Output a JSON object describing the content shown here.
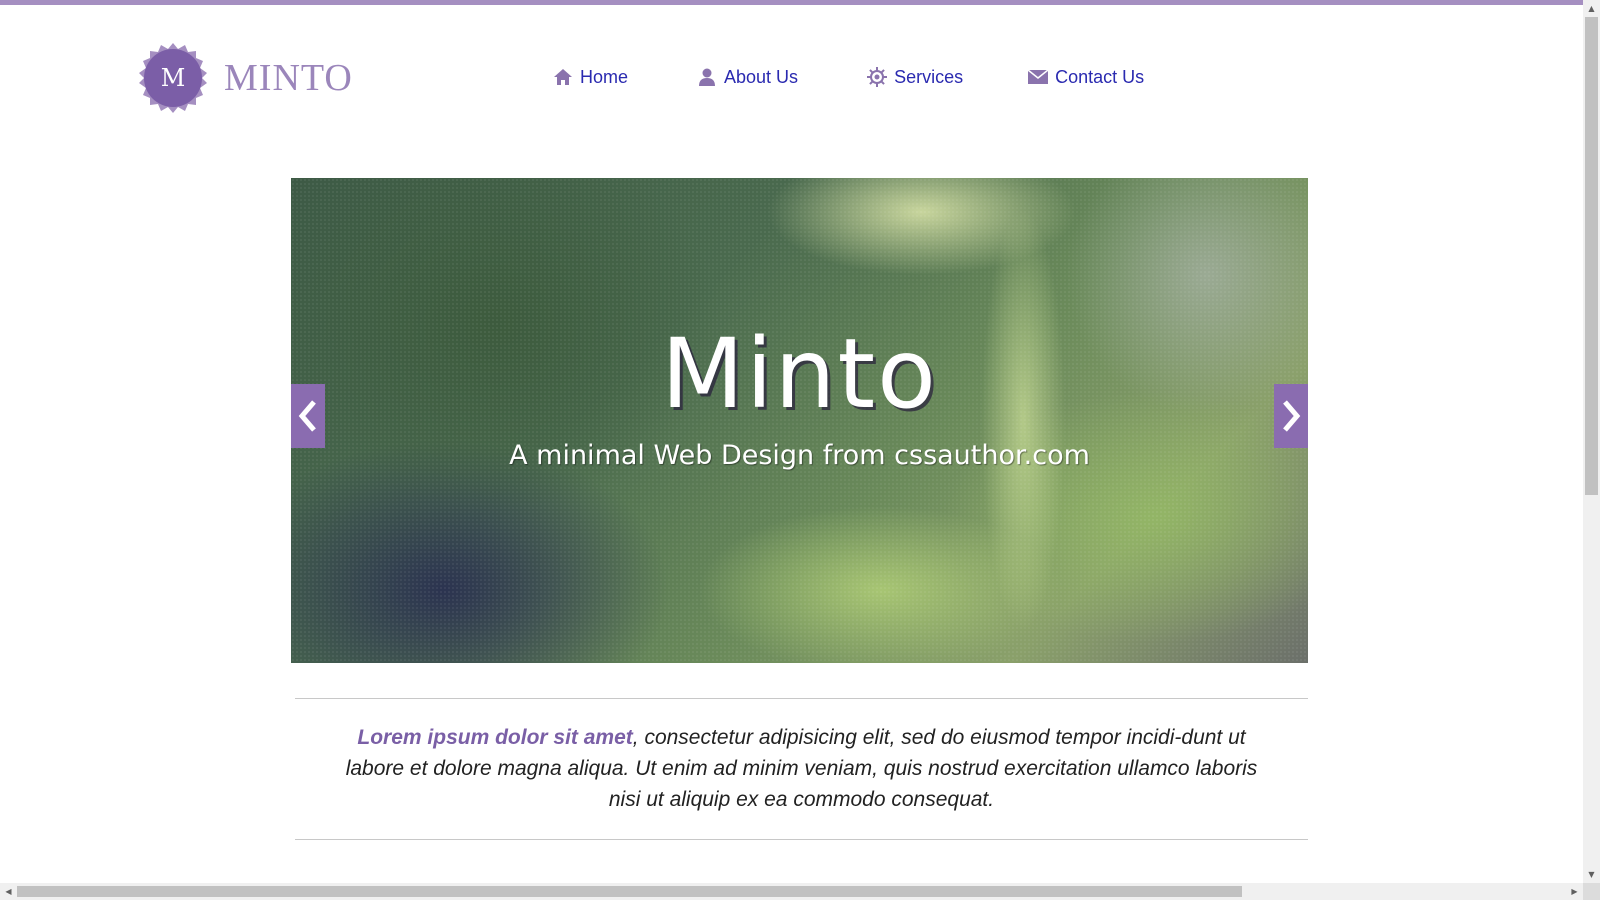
{
  "brand": {
    "logo_letter": "M",
    "name": "MINTO",
    "accent_color": "#7b5ea7",
    "accent_light": "#a58fc1"
  },
  "nav": {
    "home": {
      "label": "Home",
      "icon": "home-icon"
    },
    "about": {
      "label": "About Us",
      "icon": "user-icon"
    },
    "services": {
      "label": "Services",
      "icon": "gear-icon"
    },
    "contact": {
      "label": "Contact Us",
      "icon": "mail-icon"
    }
  },
  "slider": {
    "title": "Minto",
    "subtitle": "A minimal Web Design  from cssauthor.com",
    "prev_icon": "chevron-left-icon",
    "next_icon": "chevron-right-icon"
  },
  "intro": {
    "lead": "Lorem ipsum dolor sit amet",
    "body": ", consectetur adipisicing elit, sed do eiusmod tempor incidi-dunt ut labore et dolore magna aliqua. Ut enim ad minim veniam, quis nostrud exercitation ullamco laboris nisi ut aliquip ex ea commodo consequat."
  },
  "scrollbars": {
    "up_arrow": "▲",
    "down_arrow": "▼",
    "left_arrow": "◀",
    "right_arrow": "▶"
  }
}
